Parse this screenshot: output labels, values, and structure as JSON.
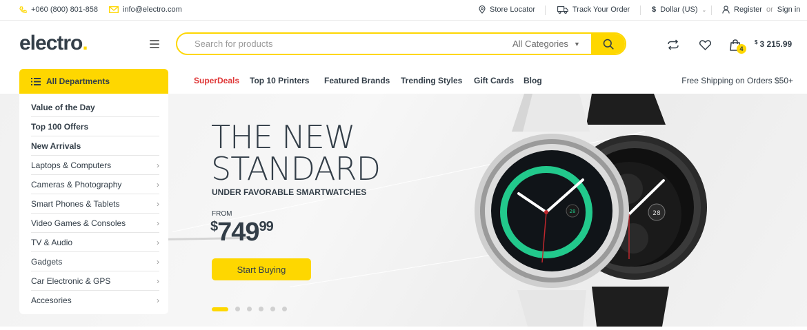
{
  "topbar": {
    "phone": "+060 (800) 801-858",
    "email": "info@electro.com",
    "store_locator": "Store Locator",
    "track_order": "Track Your Order",
    "currency": "Dollar (US)",
    "register": "Register",
    "or": "or",
    "signin": "Sign in"
  },
  "header": {
    "logo_text": "electro",
    "logo_dot": ".",
    "search_placeholder": "Search for products",
    "category_select": "All Categories",
    "cart_count": "4",
    "cart_currency": "$",
    "cart_total": "3 215.99"
  },
  "departments": {
    "title": "All Departments",
    "items": [
      {
        "label": "Value of the Day",
        "bold": true
      },
      {
        "label": "Top 100 Offers",
        "bold": true
      },
      {
        "label": "New Arrivals",
        "bold": true
      },
      {
        "label": "Laptops & Computers",
        "bold": false
      },
      {
        "label": "Cameras & Photography",
        "bold": false
      },
      {
        "label": "Smart Phones & Tablets",
        "bold": false
      },
      {
        "label": "Video Games & Consoles",
        "bold": false
      },
      {
        "label": "TV & Audio",
        "bold": false
      },
      {
        "label": "Gadgets",
        "bold": false
      },
      {
        "label": "Car Electronic & GPS",
        "bold": false
      },
      {
        "label": "Accesories",
        "bold": false
      }
    ]
  },
  "nav": {
    "items": [
      "SuperDeals",
      "Top 10 Printers",
      "Featured Brands",
      "Trending Styles",
      "Gift Cards",
      "Blog"
    ],
    "free_shipping": "Free Shipping on Orders $50+"
  },
  "hero": {
    "title_line1": "THE NEW",
    "title_line2": "STANDARD",
    "subtitle": "UNDER FAVORABLE SMARTWATCHES",
    "from_label": "FROM",
    "price_currency": "$",
    "price_main": "749",
    "price_cents": "99",
    "button_label": "Start Buying",
    "slide_count": 6,
    "active_slide": 1,
    "watch_date": "28"
  },
  "colors": {
    "accent": "#fed700",
    "text": "#333e48",
    "superdeals": "#df3737",
    "watch_ring": "#22c98c"
  }
}
